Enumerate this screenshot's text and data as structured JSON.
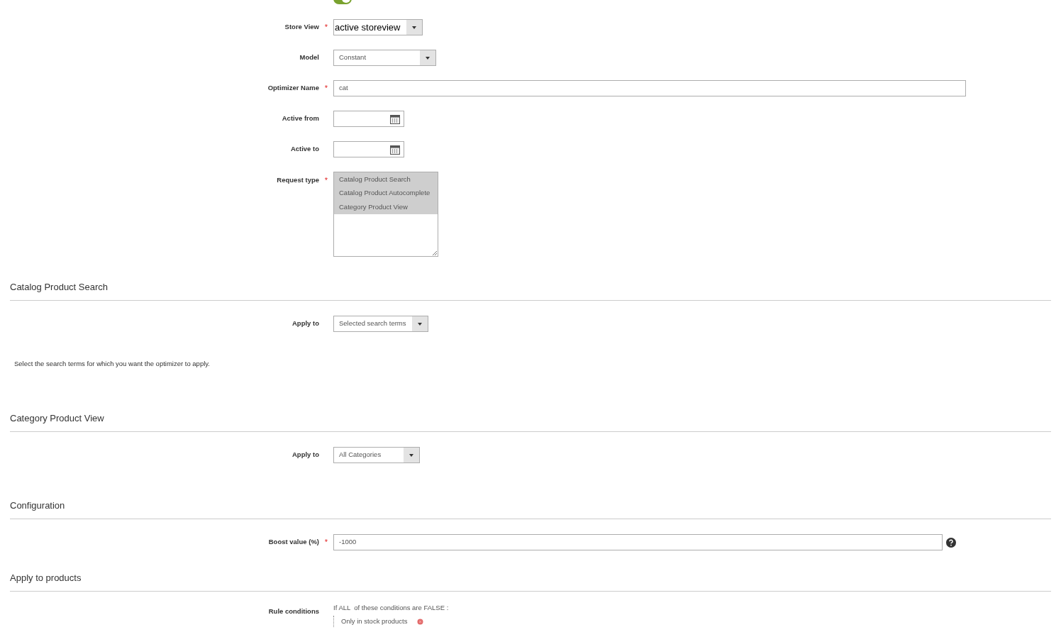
{
  "general": {
    "toggle": {
      "on": true
    },
    "fields": [
      {
        "kind": "select",
        "label": "Store View",
        "required_mark": "*",
        "value": "active storeview"
      },
      {
        "kind": "select",
        "label": "Model",
        "value": "Constant"
      },
      {
        "kind": "text",
        "label": "Optimizer Name",
        "required_mark": "*",
        "value": "cat"
      },
      {
        "kind": "date",
        "label": "Active from"
      },
      {
        "kind": "date",
        "label": "Active to"
      },
      {
        "kind": "multiselect",
        "label": "Request type",
        "required_mark": "*",
        "options": [
          {
            "label": "Catalog Product Search",
            "selected": true
          },
          {
            "label": "Catalog Product Autocomplete",
            "selected": true
          },
          {
            "label": "Category Product View",
            "selected": true
          }
        ]
      }
    ]
  },
  "sections": [
    {
      "title": "Catalog Product Search",
      "fields": [
        {
          "kind": "select",
          "label": "Apply to",
          "value": "Selected search terms"
        }
      ],
      "note": "Select the search terms for which you want the optimizer to apply."
    },
    {
      "title": "Category Product View",
      "fields": [
        {
          "kind": "select",
          "label": "Apply to",
          "value": "All Categories"
        }
      ]
    },
    {
      "title": "Configuration",
      "fields": [
        {
          "kind": "text",
          "label": "Boost value (%)",
          "required_mark": "*",
          "value": "-1000",
          "help": true
        }
      ]
    },
    {
      "title": "Apply to products",
      "fields": [
        {
          "kind": "conditions",
          "label": "Rule conditions",
          "intro": "If ALL  of these conditions are FALSE :",
          "conditions": [
            "Only in stock products"
          ]
        }
      ]
    }
  ]
}
